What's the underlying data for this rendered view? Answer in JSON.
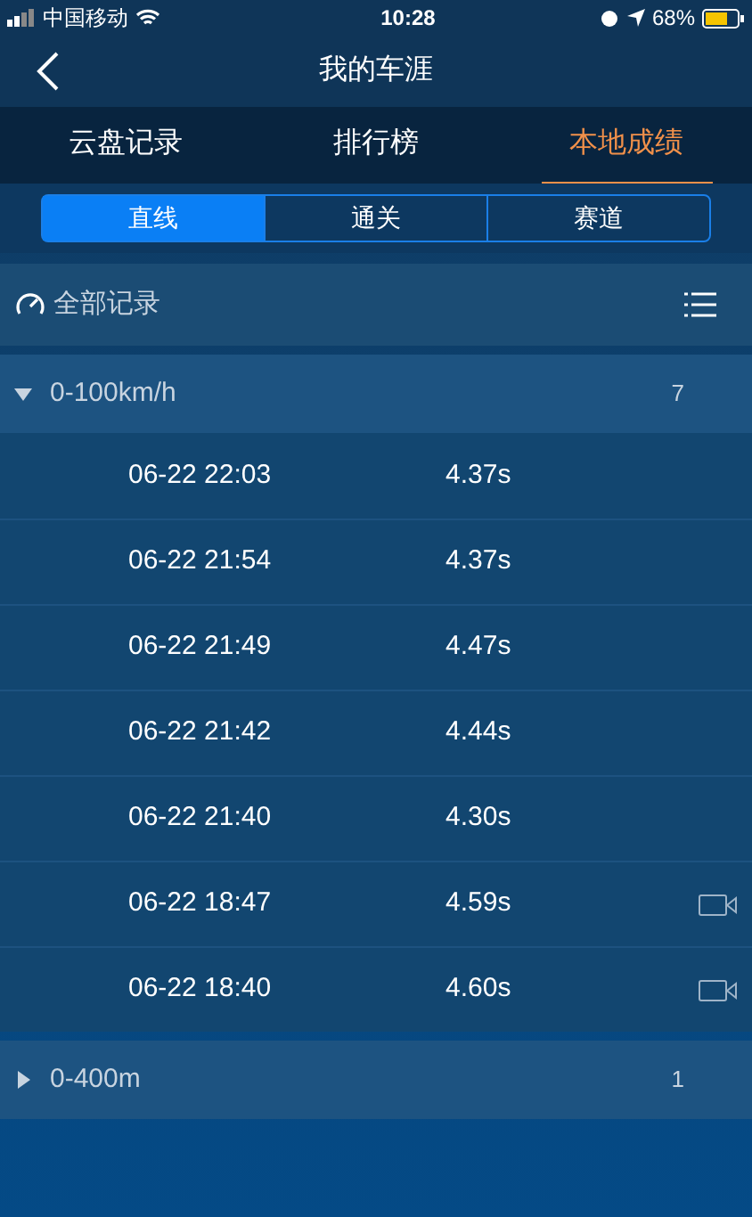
{
  "status_bar": {
    "carrier": "中国移动",
    "time": "10:28",
    "battery": "68%"
  },
  "nav": {
    "title": "我的车涯"
  },
  "tabs": [
    {
      "label": "云盘记录",
      "selected": false
    },
    {
      "label": "排行榜",
      "selected": false
    },
    {
      "label": "本地成绩",
      "selected": true
    }
  ],
  "segments": [
    {
      "label": "直线",
      "selected": true
    },
    {
      "label": "通关",
      "selected": false
    },
    {
      "label": "赛道",
      "selected": false
    }
  ],
  "filter": {
    "label": "全部记录"
  },
  "groups": [
    {
      "name": "0-100km/h",
      "count": "7",
      "expanded": true,
      "records": [
        {
          "time": "06-22 22:03",
          "result": "4.37s",
          "video": false
        },
        {
          "time": "06-22 21:54",
          "result": "4.37s",
          "video": false
        },
        {
          "time": "06-22 21:49",
          "result": "4.47s",
          "video": false
        },
        {
          "time": "06-22 21:42",
          "result": "4.44s",
          "video": false
        },
        {
          "time": "06-22 21:40",
          "result": "4.30s",
          "video": false
        },
        {
          "time": "06-22 18:47",
          "result": "4.59s",
          "video": true
        },
        {
          "time": "06-22 18:40",
          "result": "4.60s",
          "video": true
        }
      ]
    },
    {
      "name": "0-400m",
      "count": "1",
      "expanded": false
    }
  ]
}
